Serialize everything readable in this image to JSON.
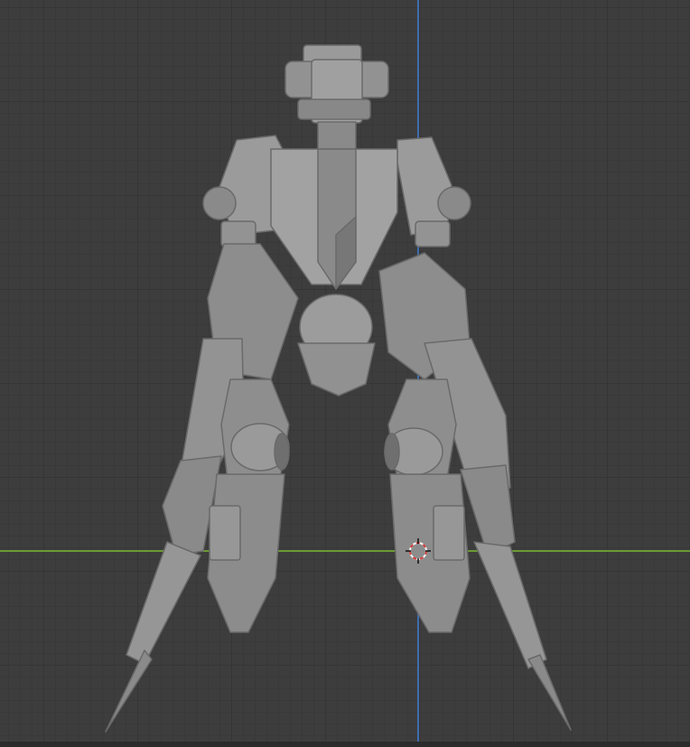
{
  "viewport": {
    "background": "#3d3d3d",
    "grid_minor": "#393939",
    "grid_major": "#353535",
    "x_axis_color": "#6a9a34",
    "z_axis_color": "#3f6eb0"
  },
  "scene": {
    "object": "robot-mech-back-view",
    "material_color": "#8f8f8f",
    "shading": "solid"
  },
  "cursor": {
    "icon": "3d-cursor-icon",
    "ring_color_a": "#d23a3a",
    "ring_color_b": "#f0f0f0"
  }
}
